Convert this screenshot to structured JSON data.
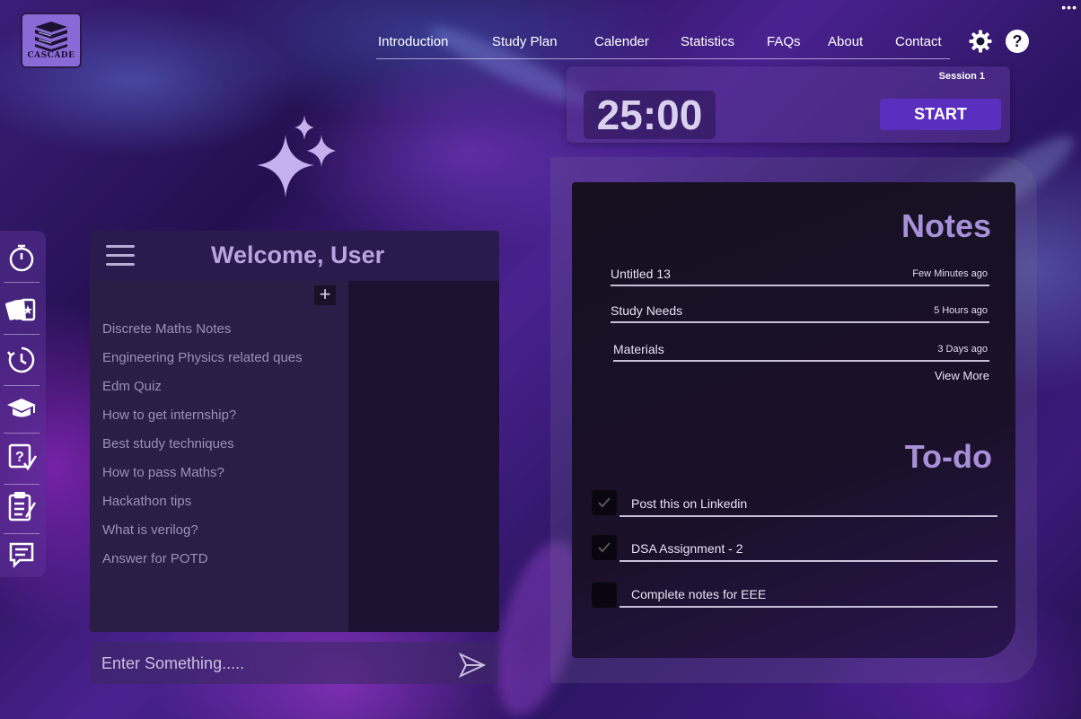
{
  "app": {
    "logo_text": "CASCADE"
  },
  "nav": {
    "items": [
      "Introduction",
      "Study Plan",
      "Calender",
      "Statistics",
      "FAQs",
      "About",
      "Contact"
    ],
    "more": "•••"
  },
  "icons": {
    "settings": "gear-icon",
    "help": "help-icon"
  },
  "timer": {
    "session": "Session 1",
    "time": "25:00",
    "start_label": "START"
  },
  "sidebar": {
    "items": [
      "stopwatch-icon",
      "flashcards-icon",
      "timer-icon",
      "graduation-cap-icon",
      "quiz-icon",
      "checklist-icon",
      "chat-icon"
    ]
  },
  "chat": {
    "welcome": "Welcome, User",
    "add": "+",
    "history": [
      "Discrete Maths Notes",
      "Engineering Physics related ques",
      "Edm Quiz",
      "How to get internship?",
      "Best study techniques",
      "How to pass Maths?",
      "Hackathon tips",
      "What is verilog?",
      "Answer for POTD"
    ],
    "input_placeholder": "Enter Something....."
  },
  "notes": {
    "title": "Notes",
    "items": [
      {
        "name": "Untitled 13",
        "time": "Few Minutes ago"
      },
      {
        "name": "Study Needs",
        "time": "5 Hours ago"
      },
      {
        "name": "Materials",
        "time": "3 Days ago"
      }
    ],
    "view_more": "View More"
  },
  "todo": {
    "title": "To-do",
    "items": [
      {
        "text": "Post this on Linkedin",
        "checked": true
      },
      {
        "text": "DSA Assignment - 2",
        "checked": true
      },
      {
        "text": "Complete notes for EEE",
        "checked": false
      }
    ]
  },
  "colors": {
    "accent": "#5a2fc0",
    "heading": "#a890d8",
    "panel": "#1c1230"
  }
}
